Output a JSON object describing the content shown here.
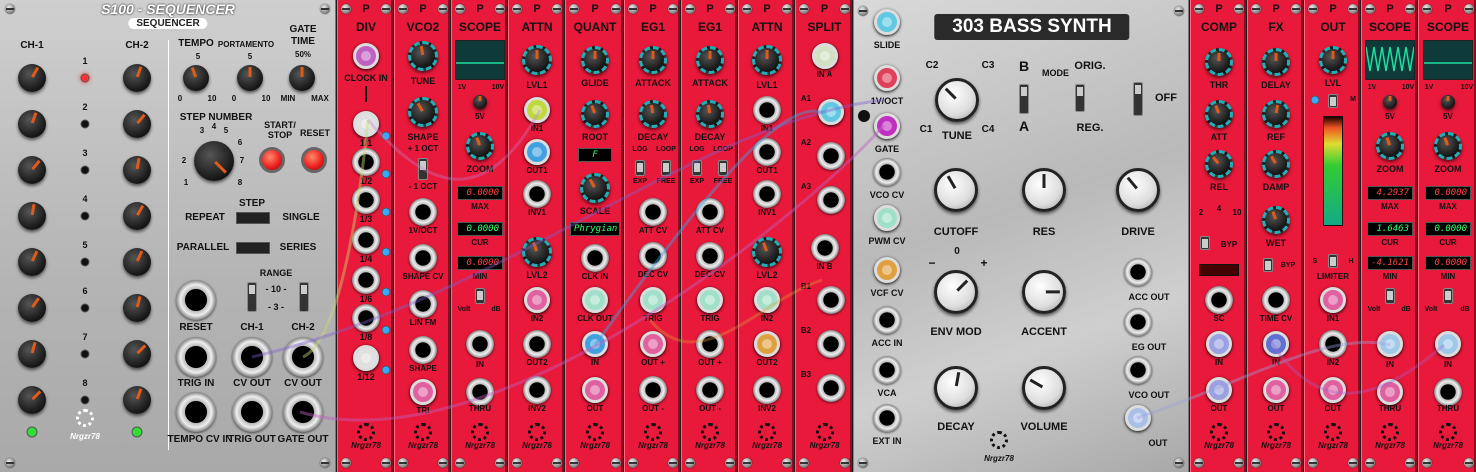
{
  "sequencer": {
    "title": "S100 - SEQUENCER",
    "subtitle": "SEQUENCER",
    "ch1": "CH-1",
    "ch2": "CH-2",
    "tempo": "TEMPO",
    "portamento": "PORTAMENTO",
    "gate_time": "GATE",
    "gate_time2": "TIME",
    "pct": "50%",
    "tempo_scale": [
      "5",
      "0",
      "10"
    ],
    "porta_scale": [
      "5",
      "0",
      "10"
    ],
    "min": "MIN",
    "max": "MAX",
    "step_number": "STEP NUMBER",
    "step_marks": [
      "3",
      "4",
      "5",
      "2",
      "6",
      "7",
      "1",
      "8"
    ],
    "start_stop": "START/",
    "stop": "STOP",
    "reset": "RESET",
    "step": "STEP",
    "repeat": "REPEAT",
    "single": "SINGLE",
    "parallel": "PARALLEL",
    "series": "SERIES",
    "range": "RANGE",
    "range10": "- 10 -",
    "range3": "- 3 -",
    "steps": [
      "1",
      "2",
      "3",
      "4",
      "5",
      "6",
      "7",
      "8"
    ],
    "jacks": {
      "reset": "RESET",
      "ch1": "CH-1",
      "ch2": "CH-2",
      "trig_in": "TRIG IN",
      "cv_out": "CV OUT",
      "cv_out2": "CV OUT",
      "tempo_cv_in": "TEMPO CV IN",
      "trig_out": "TRIG OUT",
      "gate_out": "GATE OUT"
    },
    "brand": "Nrgzr78"
  },
  "modules": {
    "div": {
      "title": "DIV",
      "clock_in": "CLOCK IN",
      "outs": [
        "1/1",
        "1/2",
        "1/3",
        "1/4",
        "1/6",
        "1/8",
        "1/12"
      ]
    },
    "vco2": {
      "title": "VCO2",
      "tune": "TUNE",
      "shape": "SHAPE",
      "plus1": "+ 1 OCT",
      "minus1": "- 1 OCT",
      "jacks": [
        "1V/OCT",
        "SHAPE CV",
        "LIN FM",
        "SHAPE",
        "TRI"
      ]
    },
    "scope1": {
      "title": "SCOPE",
      "v1": "1V",
      "v10": "10V",
      "v5": "5V",
      "zoom": "ZOOM",
      "max": "MAX",
      "cur": "CUR",
      "min": "MIN",
      "max_val": "0.0000",
      "cur_val": "0.0000",
      "min_val": "0.0000",
      "volt": "Volt",
      "db": "dB",
      "in": "IN",
      "thru": "THRU"
    },
    "attn1": {
      "title": "ATTN",
      "lvl1": "LVL1",
      "in1": "IN1",
      "out1": "OUT1",
      "inv1": "INV1",
      "lvl2": "LVL2",
      "in2": "IN2",
      "out2": "OUT2",
      "inv2": "INV2"
    },
    "quant": {
      "title": "QUANT",
      "glide": "GLIDE",
      "root": "ROOT",
      "root_val": "F",
      "scale": "SCALE",
      "scale_val": "Phrygian",
      "clk_in": "CLK IN",
      "clk_out": "CLK OUT",
      "in": "IN",
      "out": "OUT"
    },
    "eg1": {
      "title": "EG1",
      "attack": "ATTACK",
      "decay": "DECAY",
      "log": "LOG",
      "loop": "LOOP",
      "exp": "EXP",
      "free": "FREE",
      "att_cv": "ATT CV",
      "dec_cv": "DEC CV",
      "trig": "TRIG",
      "out_p": "OUT +",
      "out_m": "OUT -"
    },
    "eg2": {
      "title": "EG1",
      "attack": "ATTACK",
      "decay": "DECAY",
      "log": "LOG",
      "loop": "LOOP",
      "exp": "EXP",
      "free": "FREE",
      "att_cv": "ATT CV",
      "dec_cv": "DEC CV",
      "trig": "TRIG",
      "out_p": "OUT +",
      "out_m": "OUT -"
    },
    "attn2": {
      "title": "ATTN",
      "lvl1": "LVL1",
      "in1": "IN1",
      "out1": "OUT1",
      "inv1": "INV1",
      "lvl2": "LVL2",
      "in2": "IN2",
      "out2": "OUT2",
      "inv2": "INV2"
    },
    "split": {
      "title": "SPLIT",
      "in_a": "IN A",
      "a": [
        "A1",
        "A2",
        "A3"
      ],
      "in_b": "IN B",
      "b": [
        "B1",
        "B2",
        "B3"
      ]
    },
    "bass": {
      "title": "303 BASS SYNTH",
      "slide": "SLIDE",
      "voct": "1V/OCT",
      "gate": "GATE",
      "vco_cv": "VCO CV",
      "pwm_cv": "PWM CV",
      "vcf_cv": "VCF CV",
      "acc_in": "ACC IN",
      "vca": "VCA",
      "ext_in": "EXT IN",
      "c1": "C1",
      "c2": "C2",
      "c3": "C3",
      "c4": "C4",
      "tune": "TUNE",
      "b": "B",
      "a": "A",
      "mode": "MODE",
      "orig": "ORIG.",
      "reg": "REG.",
      "off": "OFF",
      "cutoff": "CUTOFF",
      "res": "RES",
      "drive": "DRIVE",
      "envmod": "ENV MOD",
      "accent": "ACCENT",
      "decay": "DECAY",
      "volume": "VOLUME",
      "minus": "−",
      "zero": "0",
      "plus": "+",
      "acc_out": "ACC OUT",
      "eg_out": "EG OUT",
      "vco_out": "VCO OUT",
      "out": "OUT",
      "brand": "Nrgzr78"
    },
    "comp": {
      "title": "COMP",
      "thr": "THR",
      "att": "ATT",
      "rel": "REL",
      "s2": "2",
      "s4": "4",
      "s10": "10",
      "byp": "BYP",
      "sc": "SC",
      "in": "IN",
      "out": "OUT"
    },
    "fx": {
      "title": "FX",
      "delay": "DELAY",
      "ref": "REF",
      "damp": "DAMP",
      "wet": "WET",
      "byp": "BYP",
      "time_cv": "TIME CV",
      "in": "IN",
      "out": "OUT"
    },
    "outm": {
      "title": "OUT",
      "lvl": "LVL",
      "m": "M",
      "s": "S",
      "h": "H",
      "limiter": "LIMITER",
      "in1": "IN1",
      "in2": "IN2",
      "out": "OUT"
    },
    "scope2": {
      "title": "SCOPE",
      "v1": "1V",
      "v10": "10V",
      "v5": "5V",
      "zoom": "ZOOM",
      "max": "MAX",
      "cur": "CUR",
      "min": "MIN",
      "max_val": "4.2937",
      "cur_val": "1.6463",
      "min_val": "-4.1621",
      "volt": "Volt",
      "db": "dB",
      "in": "IN",
      "thru": "THRU"
    },
    "scope3": {
      "title": "SCOPE",
      "v1": "1V",
      "v10": "10V",
      "v5": "5V",
      "zoom": "ZOOM",
      "max": "MAX",
      "cur": "CUR",
      "min": "MIN",
      "max_val": "0.0000",
      "cur_val": "0.0000",
      "min_val": "0.0000",
      "volt": "Volt",
      "db": "dB",
      "in": "IN",
      "thru": "THRU"
    }
  },
  "hp_mark": "P",
  "red_brand": "Nrgzr78",
  "colors": {
    "panel_red": "#e8193a",
    "teal_accent": "#1fb0b7",
    "scope_green": "#20e0a0",
    "led_red": "#ff2222"
  }
}
